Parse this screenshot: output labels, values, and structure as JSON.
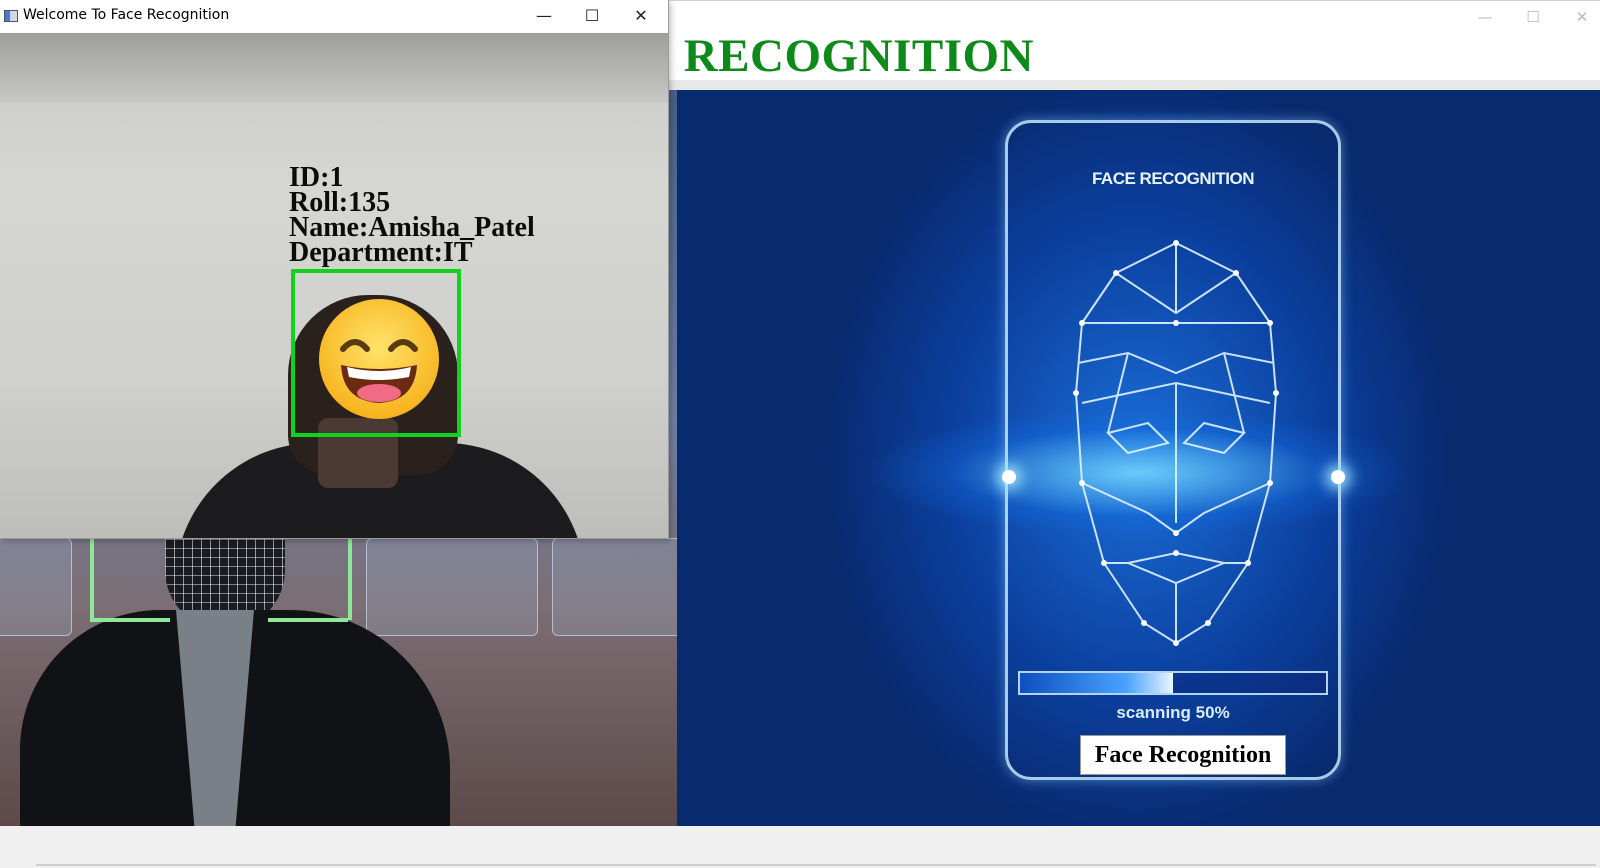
{
  "main_window": {
    "heading": "E RECOGNITION",
    "controls": {
      "minimize": "—",
      "maximize": "☐",
      "close": "✕"
    },
    "colors": {
      "heading": "#0d8a1a"
    },
    "image": {
      "phone_label": "FACE RECOGNITION",
      "scan_text": "scanning 50%",
      "scan_progress": 0.5,
      "button_label": "Face Recognition"
    }
  },
  "camera_window": {
    "title": "Welcome To Face Recognition",
    "controls": {
      "minimize": "—",
      "maximize": "☐",
      "close": "✕"
    },
    "overlay": {
      "id": "ID:1",
      "roll": "Roll:135",
      "name": "Name:Amisha_Patel",
      "department": "Department:IT"
    },
    "colors": {
      "face_box": "#13d21e"
    },
    "face_cover_icon": "grinning-face-emoji-icon"
  }
}
